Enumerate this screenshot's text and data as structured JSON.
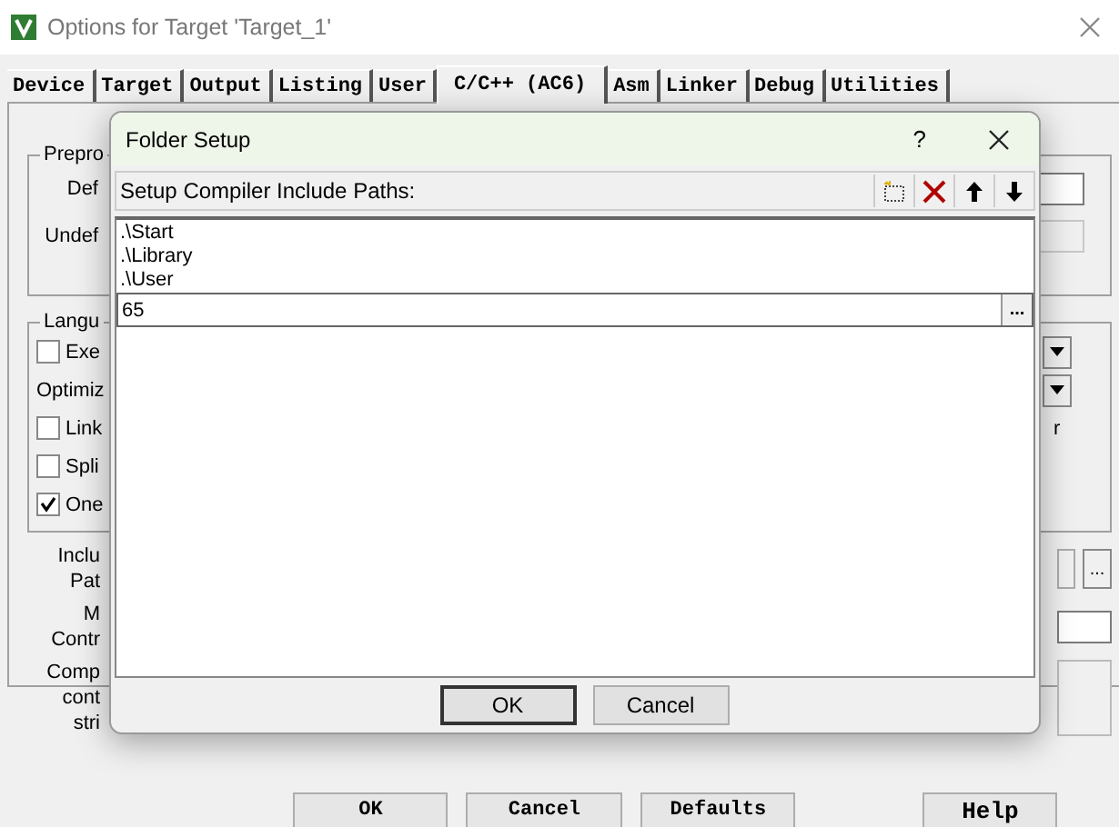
{
  "window": {
    "title": "Options for Target 'Target_1'"
  },
  "tabs": [
    {
      "label": "Device",
      "selected": false
    },
    {
      "label": "Target",
      "selected": false
    },
    {
      "label": "Output",
      "selected": false
    },
    {
      "label": "Listing",
      "selected": false
    },
    {
      "label": "User",
      "selected": false
    },
    {
      "label": "C/C++ (AC6)",
      "selected": true
    },
    {
      "label": "Asm",
      "selected": false
    },
    {
      "label": "Linker",
      "selected": false
    },
    {
      "label": "Debug",
      "selected": false
    },
    {
      "label": "Utilities",
      "selected": false
    }
  ],
  "preprocessor": {
    "legend": "Prepro",
    "rows": [
      {
        "label": "Def",
        "disabled": false
      },
      {
        "label": "Undef",
        "disabled": true
      }
    ]
  },
  "language": {
    "legend": "Langu",
    "rows": [
      {
        "kind": "checkbox",
        "label": "Exe",
        "checked": false,
        "dropdown": true
      },
      {
        "kind": "label",
        "label": "Optimiz",
        "dropdown": true
      },
      {
        "kind": "checkbox",
        "label": "Link",
        "checked": false,
        "dropdown": false,
        "right_text": "r"
      },
      {
        "kind": "checkbox",
        "label": "Spli",
        "checked": false,
        "dropdown": false
      },
      {
        "kind": "checkbox",
        "label": "One",
        "checked": true,
        "dropdown": false
      }
    ]
  },
  "fields": [
    {
      "kind": "path",
      "label": "Inclu\nPat",
      "browse": "..."
    },
    {
      "kind": "field",
      "label": "M\nContr"
    },
    {
      "kind": "box",
      "label": "Comp\ncont\nstri"
    }
  ],
  "buttons": [
    "OK",
    "Cancel",
    "Defaults",
    "Help"
  ],
  "folder_dialog": {
    "title": "Folder Setup",
    "help": "?",
    "label": "Setup Compiler Include Paths:",
    "paths": [
      ".\\Start",
      ".\\Library",
      ".\\User"
    ],
    "edit": {
      "value": "65",
      "browse": "..."
    },
    "buttons": [
      {
        "label": "OK",
        "default": true
      },
      {
        "label": "Cancel",
        "default": false
      }
    ]
  }
}
